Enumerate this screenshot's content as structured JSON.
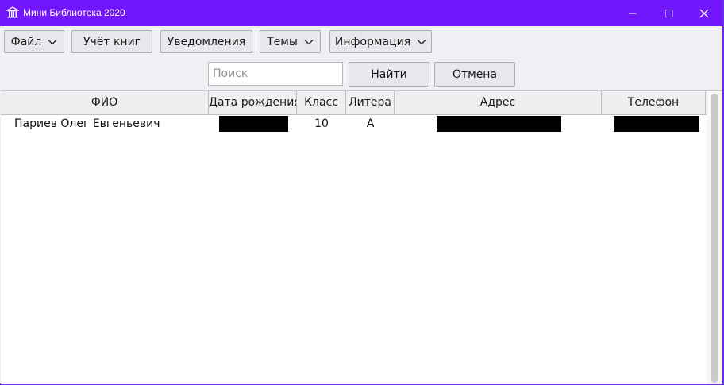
{
  "window": {
    "title": "Мини Библиотека 2020",
    "accent_color": "#7216fb",
    "icons": {
      "app": "library-icon",
      "minimize": "minimize-icon",
      "maximize": "maximize-icon",
      "close": "close-icon"
    }
  },
  "menu": {
    "file": "Файл",
    "books": "Учёт книг",
    "notifications": "Уведомления",
    "themes": "Темы",
    "info": "Информация"
  },
  "search": {
    "placeholder": "Поиск",
    "value": "",
    "find_label": "Найти",
    "cancel_label": "Отмена"
  },
  "table": {
    "columns": [
      "ФИО",
      "Дата рождения",
      "Класс",
      "Литера",
      "Адрес",
      "Телефон"
    ],
    "rows": [
      {
        "fio": "Париев Олег Евгеньевич",
        "birth_date": "",
        "class": "10",
        "litera": "А",
        "address": "",
        "phone": ""
      }
    ],
    "redacted_fields": [
      "birth_date",
      "address",
      "phone"
    ]
  }
}
